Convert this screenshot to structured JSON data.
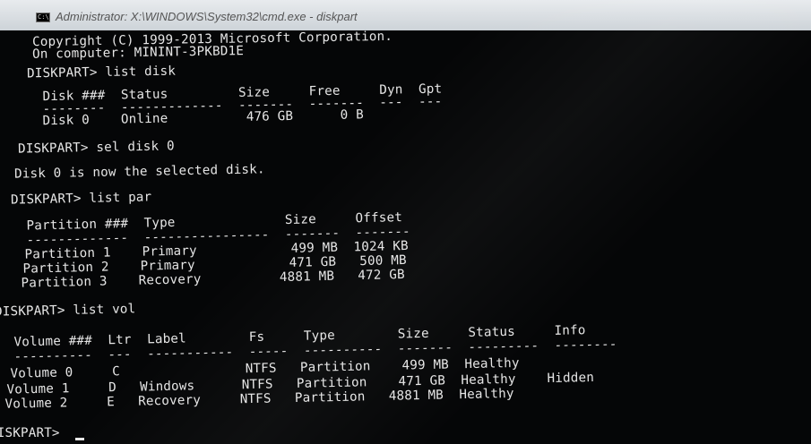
{
  "window": {
    "title": "Administrator: X:\\WINDOWS\\System32\\cmd.exe - diskpart",
    "icon_label": "C:\\"
  },
  "console": {
    "lines": [
      {
        "text": "Copyright (C) 1999-2013 Microsoft Corporation."
      },
      {
        "text": "On computer: MININT-3PKBD1E"
      },
      {
        "text": "DISKPART> list disk"
      },
      {
        "text": "  Disk ###  Status         Size     Free     Dyn  Gpt"
      },
      {
        "text": "  --------  -------------  -------  -------  ---  ---"
      },
      {
        "text": "  Disk 0    Online          476 GB      0 B"
      },
      {
        "text": "DISKPART> sel disk 0"
      },
      {
        "text": "Disk 0 is now the selected disk."
      },
      {
        "text": "DISKPART> list par"
      },
      {
        "text": "  Partition ###  Type              Size     Offset"
      },
      {
        "text": "  -------------  ----------------  -------  -------"
      },
      {
        "text": "  Partition 1    Primary            499 MB  1024 KB"
      },
      {
        "text": "  Partition 2    Primary            471 GB   500 MB"
      },
      {
        "text": "  Partition 3    Recovery          4881 MB   472 GB"
      },
      {
        "text": "DISKPART> list vol"
      },
      {
        "text": "  Volume ###  Ltr  Label        Fs     Type        Size     Status     Info"
      },
      {
        "text": "  ----------  ---  -----------  -----  ----------  -------  ---------  --------"
      },
      {
        "text": "  Volume 0     C                NTFS   Partition    499 MB  Healthy"
      },
      {
        "text": "  Volume 1     D   Windows      NTFS   Partition    471 GB  Healthy    Hidden"
      },
      {
        "text": "  Volume 2     E   Recovery     NTFS   Partition   4881 MB  Healthy"
      },
      {
        "text": "DISKPART> "
      }
    ]
  },
  "colors": {
    "background": "#050607",
    "text": "#e6e6e6",
    "titlebar": "#dfe3e7"
  }
}
